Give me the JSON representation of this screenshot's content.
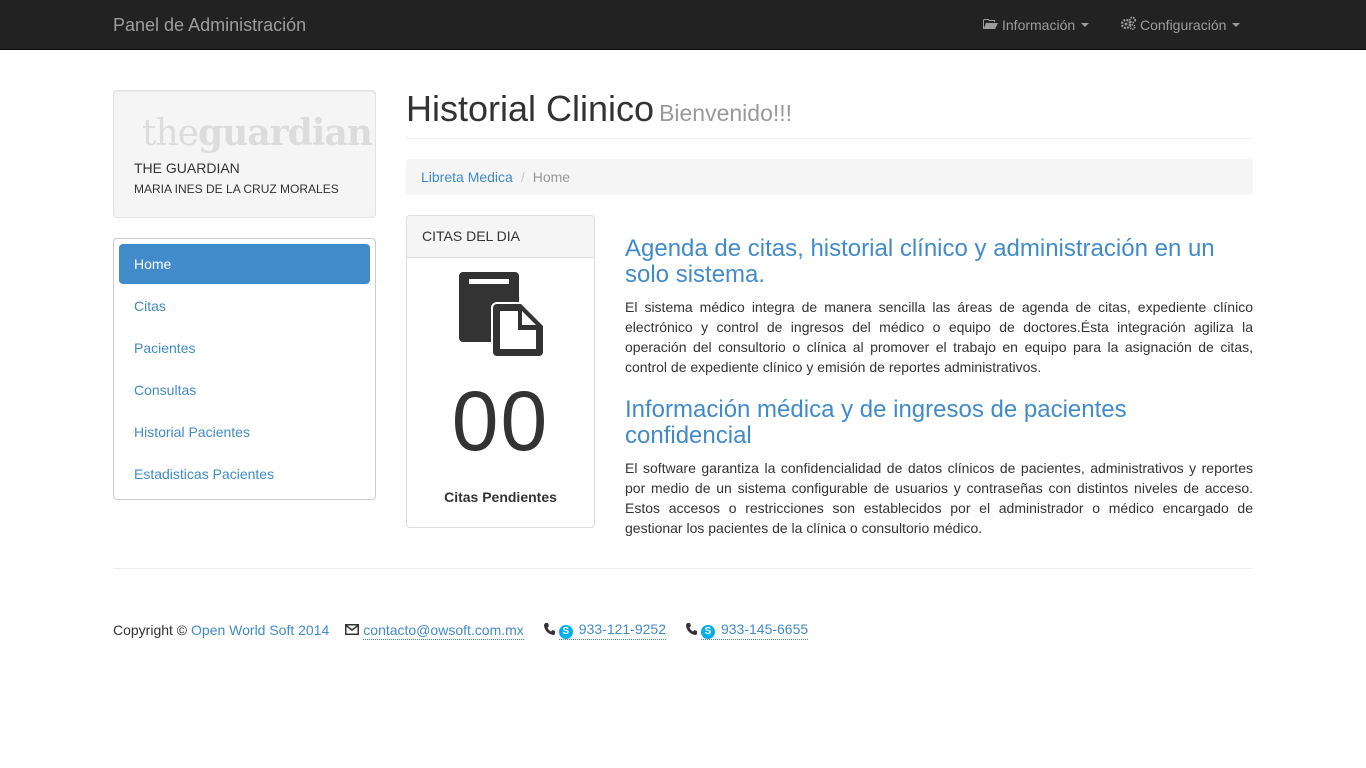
{
  "navbar": {
    "brand": "Panel de Administración",
    "info_label": "Información",
    "config_label": "Configuración"
  },
  "profile": {
    "logo_the": "the",
    "logo_guardian": "guardian",
    "title": "THE GUARDIAN",
    "name": "MARIA INES DE LA CRUZ MORALES"
  },
  "sidebar": {
    "items": [
      {
        "label": "Home",
        "active": true
      },
      {
        "label": "Citas"
      },
      {
        "label": "Pacientes"
      },
      {
        "label": "Consultas"
      },
      {
        "label": "Historial Pacientes"
      },
      {
        "label": "Estadisticas Pacientes"
      }
    ]
  },
  "header": {
    "title": "Historial Clinico",
    "subtitle": "Bienvenido!!!"
  },
  "breadcrumb": {
    "link": "Libreta Medica",
    "separator": "/",
    "active": "Home"
  },
  "panel": {
    "heading": "CITAS DEL DIA",
    "count": "00",
    "label": "Citas Pendientes"
  },
  "content": {
    "heading1": "Agenda de citas, historial clínico y administración en un solo sistema.",
    "para1": "El sistema médico integra de manera sencilla las áreas de agenda de citas, expediente clínico electrónico y control de ingresos del médico o equipo de doctores.Ésta integración agiliza la operación del consultorio o clínica al promover el trabajo en equipo para la asignación de citas, control de expediente clínico y emisión de reportes administrativos.",
    "heading2": "Información médica y de ingresos de pacientes confidencial",
    "para2": "El software garantiza la confidencialidad de datos clínicos de pacientes, administrativos y reportes por medio de un sistema configurable de usuarios y contraseñas con distintos niveles de acceso. Estos accesos o restricciones son establecidos por el administrador o médico encargado de gestionar los pacientes de la clínica o consultorio médico."
  },
  "footer": {
    "copyright": "Copyright ©",
    "company": "Open World Soft 2014",
    "email": "contacto@owsoft.com.mx",
    "phone1": "933-121-9252",
    "phone2": "933-145-6655",
    "skype_glyph": "S"
  },
  "colors": {
    "navbar_bg": "#222222",
    "accent": "#428bca",
    "skype": "#00aff0"
  }
}
